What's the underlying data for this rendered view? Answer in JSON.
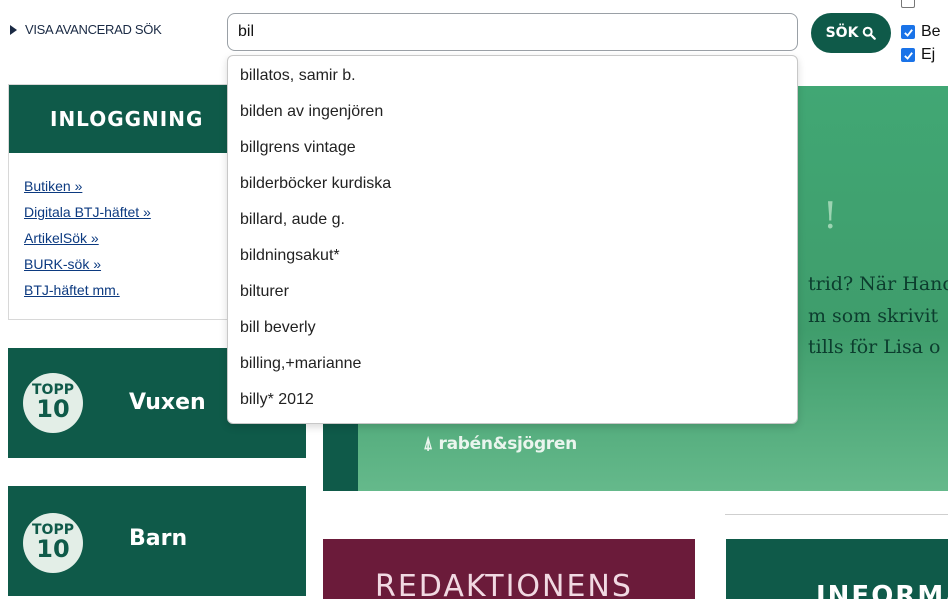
{
  "search": {
    "advanced_label": "VISA AVANCERAD SÖK",
    "query": "bil",
    "button_label": "SÖK",
    "options": [
      {
        "label": "Be",
        "checked": true
      },
      {
        "label": "Ej",
        "checked": true
      }
    ]
  },
  "autocomplete": [
    "billatos, samir b.",
    "bilden av ingenjören",
    "billgrens vintage",
    "bilderböcker kurdiska",
    "billard, aude g.",
    "bildningsakut*",
    "bilturer",
    "bill beverly",
    "billing,+marianne",
    "billy* 2012"
  ],
  "login": {
    "title": "INLOGGNING",
    "links": [
      "Butiken »",
      "Digitala BTJ-häftet »",
      "ArtikelSök »",
      "BURK-sök »",
      "BTJ-häftet mm."
    ]
  },
  "topp": {
    "badge_line1": "TOPP",
    "badge_line2": "10",
    "vuxen": "Vuxen",
    "barn": "Barn"
  },
  "banner": {
    "lines": [
      "trid? När Hand",
      "m som skrivit",
      "tills för Lisa o"
    ],
    "publisher": "rabén&sjögren",
    "mark": "!"
  },
  "sections": {
    "redaktionens": "REDAKTIONENS",
    "informa": "INFORMA"
  },
  "colors": {
    "brand_green": "#0f5a49",
    "banner_green": "#41a774",
    "maroon": "#6b1b3a",
    "checkbox_blue": "#1a73e8"
  }
}
